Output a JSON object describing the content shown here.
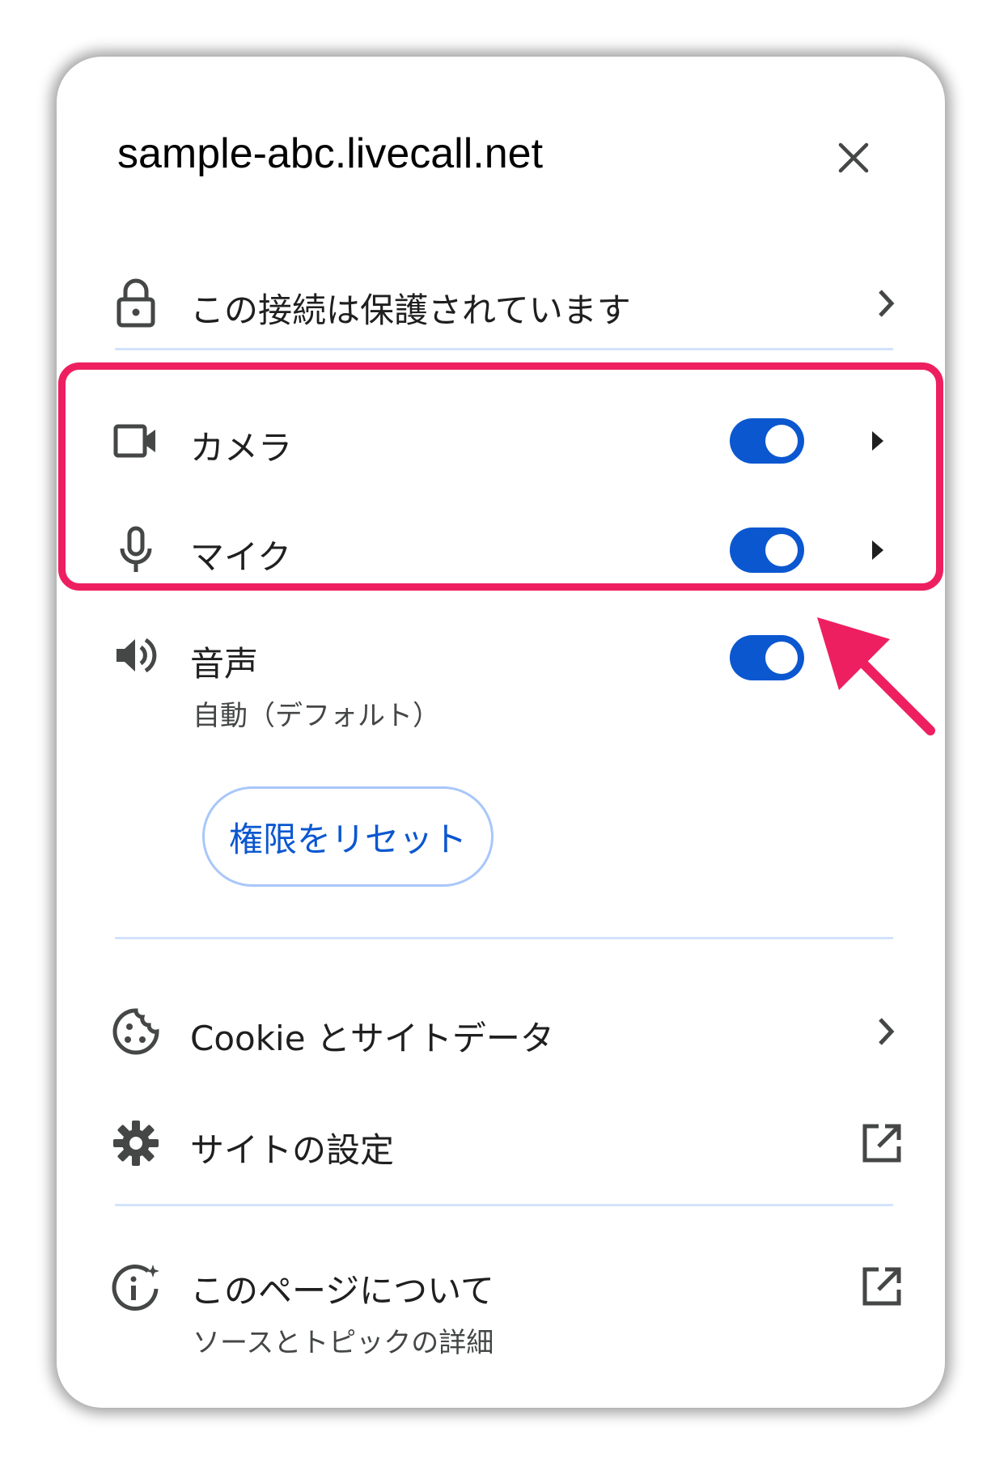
{
  "site": {
    "title": "sample-abc.livecall.net"
  },
  "connection": {
    "label": "この接続は保護されています"
  },
  "permissions": {
    "camera": {
      "label": "カメラ",
      "enabled": true
    },
    "mic": {
      "label": "マイク",
      "enabled": true
    },
    "sound": {
      "label": "音声",
      "sublabel": "自動（デフォルト）",
      "enabled": true
    }
  },
  "reset_button": {
    "label": "権限をリセット"
  },
  "cookies": {
    "label": "Cookie とサイトデータ"
  },
  "site_settings": {
    "label": "サイトの設定"
  },
  "about_page": {
    "label": "このページについて",
    "sublabel": "ソースとトピックの詳細"
  },
  "icons": {
    "close": "close-icon",
    "lock": "lock-icon",
    "camera": "video-camera-icon",
    "mic": "microphone-icon",
    "sound": "speaker-icon",
    "cookie": "cookie-icon",
    "settings": "gear-icon",
    "about": "info-sparkle-icon",
    "external": "open-in-new-icon"
  },
  "colors": {
    "accent": "#0b57d0",
    "divider": "#d3e3fd",
    "annotation": "#ee1f60"
  }
}
